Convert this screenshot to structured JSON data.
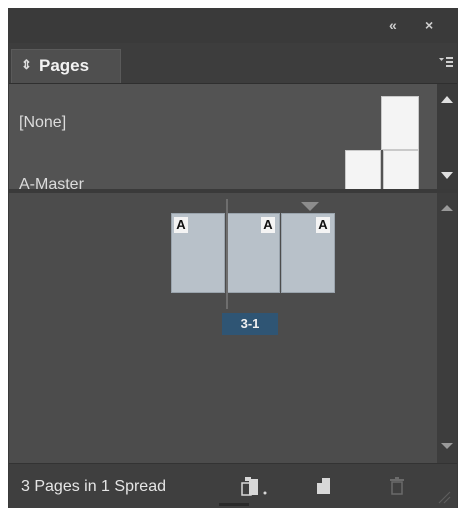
{
  "titlebar": {
    "collapse_icon": "«",
    "close_icon": "×"
  },
  "panel": {
    "tab_label": "Pages",
    "tab_arrow": "⇕",
    "menu_icon": "panel-menu-icon"
  },
  "masters": {
    "items": [
      {
        "label": "[None]"
      },
      {
        "label": "A-Master"
      }
    ]
  },
  "spread": {
    "pages": [
      {
        "badge": "A"
      },
      {
        "badge": "A"
      },
      {
        "badge": "A"
      }
    ],
    "label": "3-1"
  },
  "footer": {
    "status": "3 Pages in 1 Spread"
  },
  "colors": {
    "panel_bg": "#4a4a4a",
    "page_fill": "#b8c1c9",
    "spread_label_bg": "#2f5574"
  }
}
